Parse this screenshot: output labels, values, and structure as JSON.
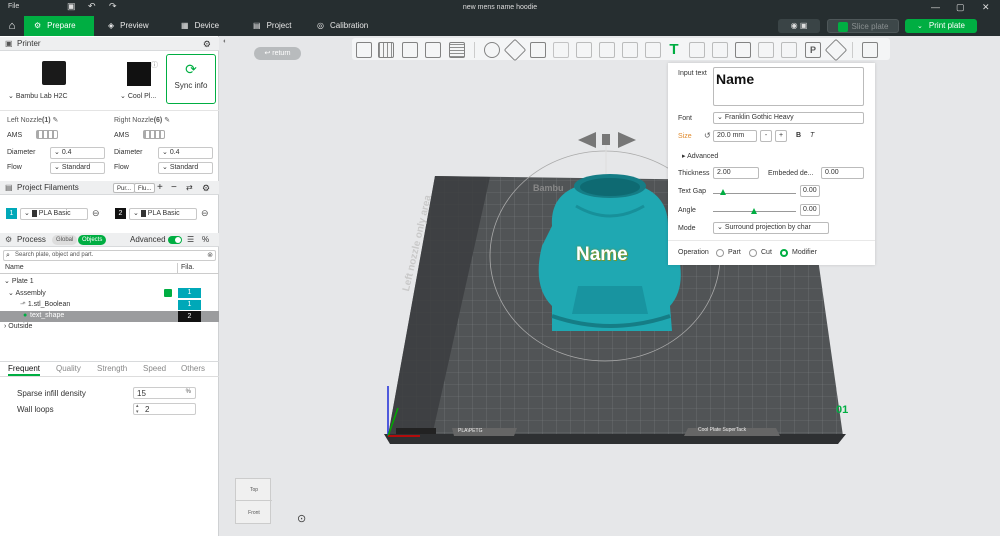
{
  "titlebar": {
    "file": "File",
    "title": "new mens name hoodie"
  },
  "nav": {
    "tabs": [
      {
        "label": "Prepare",
        "active": true
      },
      {
        "label": "Preview"
      },
      {
        "label": "Device"
      },
      {
        "label": "Project"
      },
      {
        "label": "Calibration"
      }
    ],
    "slice_plate": "Slice plate",
    "print_plate": "Print plate"
  },
  "printer": {
    "header": "Printer",
    "name": "Bambu Lab H2C",
    "plate": "Cool Pl...",
    "sync": "Sync info",
    "left_nozzle": "Left Nozzle",
    "left_nozzle_n": "(1)",
    "right_nozzle": "Right Nozzle",
    "right_nozzle_n": "(6)",
    "ams": "AMS",
    "diameter_label": "Diameter",
    "flow_label": "Flow",
    "left_diameter": "0.4",
    "left_flow": "Standard",
    "right_diameter": "0.4",
    "right_flow": "Standard"
  },
  "filaments": {
    "header": "Project Filaments",
    "btn1": "Pur...",
    "btn2": "Flu...",
    "items": [
      {
        "num": "1",
        "name": "PLA Basic",
        "color": "#00a8b8"
      },
      {
        "num": "2",
        "name": "PLA Basic",
        "color": "#111111"
      }
    ]
  },
  "process": {
    "header": "Process",
    "global": "Global",
    "objects": "Objects",
    "advanced": "Advanced",
    "search_placeholder": "Search plate, object and part.",
    "col_name": "Name",
    "col_fila": "Fila.",
    "tree": [
      {
        "label": "Plate 1",
        "fila": ""
      },
      {
        "label": "Assembly",
        "fila": "1"
      },
      {
        "label": "1.stl_Boolean",
        "fila": "1"
      },
      {
        "label": "text_shape",
        "fila": "2"
      },
      {
        "label": "Outside",
        "fila": ""
      }
    ],
    "tabs": [
      "Frequent",
      "Quality",
      "Strength",
      "Speed",
      "Others"
    ],
    "infill_label": "Sparse infill density",
    "infill_value": "15",
    "infill_unit": "%",
    "wall_label": "Wall loops",
    "wall_value": "2"
  },
  "viewport": {
    "return": "return",
    "bed_text": "Left nozzle only area",
    "bed_brand": "Bambu",
    "model_text": "Name",
    "bed_label_left": "PLA\\PETG",
    "bed_label_right": "Cool Plate SuperTack",
    "plate_number": "01",
    "cube_top": "Top",
    "cube_front": "Front"
  },
  "text_panel": {
    "input_label": "Input text",
    "input_value": "Name",
    "font_label": "Font",
    "font_value": "Franklin Gothic Heavy",
    "size_label": "Size",
    "size_value": "20.0 mm",
    "bold": "B",
    "italic": "T",
    "advanced": "Advanced",
    "thickness_label": "Thickness",
    "thickness_value": "2.00",
    "embedded_label": "Embeded de...",
    "embedded_value": "0.00",
    "gap_label": "Text Gap",
    "gap_value": "0.00",
    "angle_label": "Angle",
    "angle_value": "0.00",
    "mode_label": "Mode",
    "mode_value": "Surround projection by char",
    "operation_label": "Operation",
    "ops": [
      "Part",
      "Cut",
      "Modifier"
    ],
    "selected_op": "Modifier"
  },
  "colors": {
    "accent": "#00ae42",
    "dark": "#262e30",
    "model": "#1fa8b2"
  }
}
